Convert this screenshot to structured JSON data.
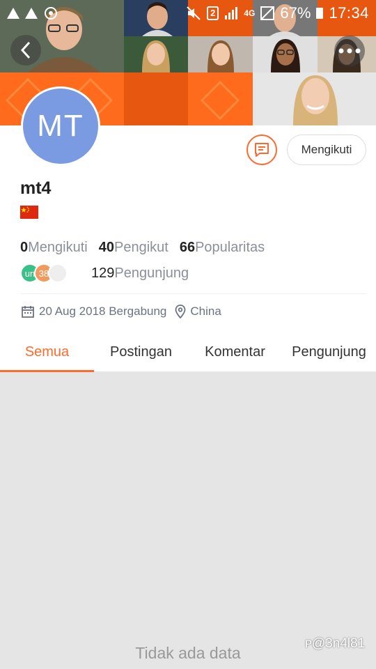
{
  "status_bar": {
    "time": "17:34",
    "battery": "67%",
    "sim": "2",
    "network": "4G"
  },
  "profile": {
    "initials": "MT",
    "username": "mt4",
    "follow_label": "Mengikuti",
    "stats": [
      {
        "value": "0",
        "label": "Mengikuti"
      },
      {
        "value": "40",
        "label": "Pengikut"
      },
      {
        "value": "66",
        "label": "Popularitas"
      }
    ],
    "visitor_avatars": [
      {
        "text": "un",
        "color": "#3cc08a"
      },
      {
        "text": "38",
        "color": "#f29a5e"
      },
      {
        "text": "",
        "color": "#eeeeee"
      }
    ],
    "visitor_count": "129",
    "visitor_label": "Pengunjung",
    "joined": "20 Aug 2018 Bergabung",
    "location": "China"
  },
  "tabs": [
    {
      "label": "Semua",
      "active": true
    },
    {
      "label": "Postingan",
      "active": false
    },
    {
      "label": "Komentar",
      "active": false
    },
    {
      "label": "Pengunjung",
      "active": false
    }
  ],
  "empty_text": "Tidak ada data",
  "watermark": "ᴩ@3n4l81",
  "colors": {
    "accent": "#ff6a2c",
    "avatar": "#7a9be2",
    "banner": "#ff6a1a"
  }
}
